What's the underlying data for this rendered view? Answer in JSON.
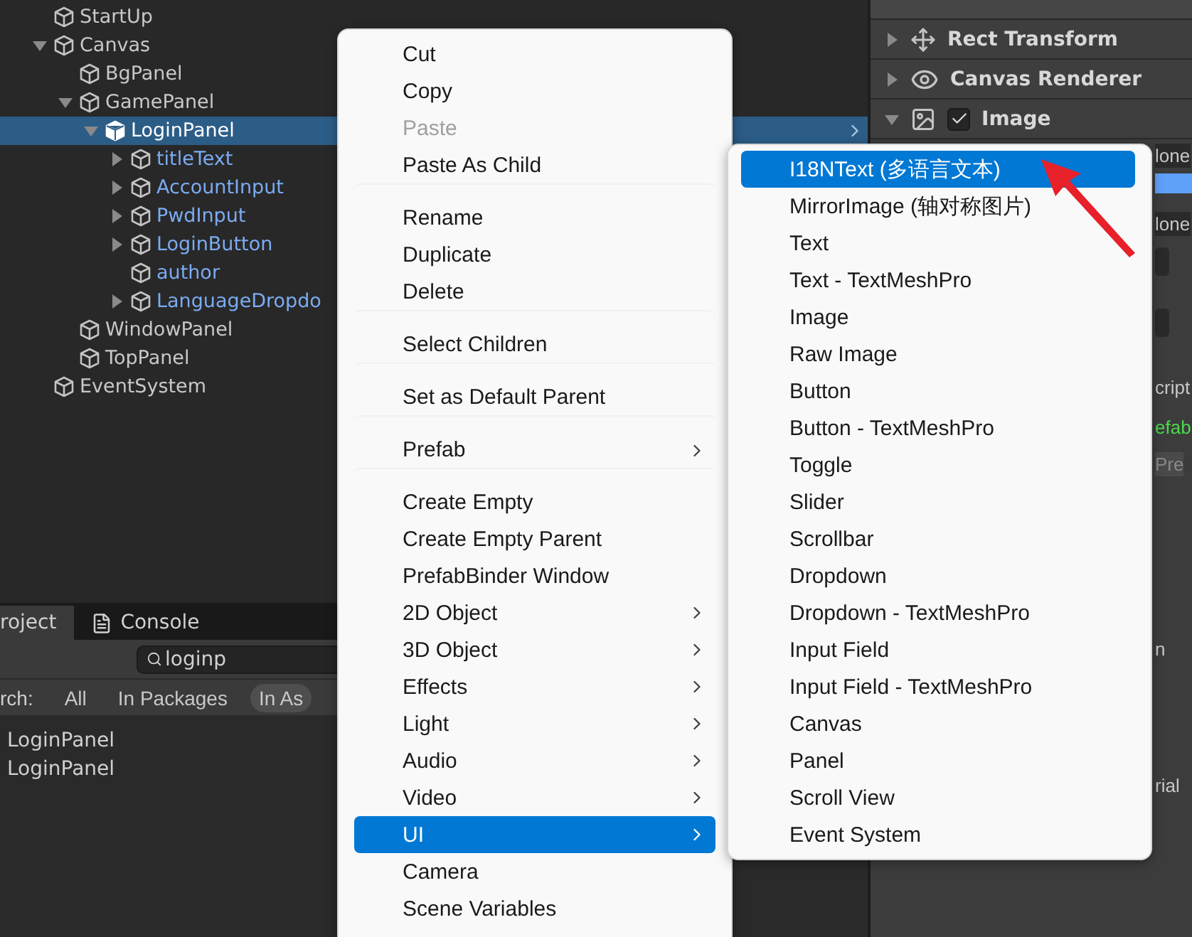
{
  "hierarchy": {
    "items": [
      {
        "name": "StartUp",
        "prefab": false,
        "selected": false
      },
      {
        "name": "Canvas",
        "prefab": false,
        "selected": false,
        "expanded": true,
        "children": [
          {
            "name": "BgPanel",
            "prefab": false,
            "selected": false
          },
          {
            "name": "GamePanel",
            "prefab": false,
            "selected": false,
            "expanded": true,
            "children": [
              {
                "name": "LoginPanel",
                "prefab": false,
                "selected": true,
                "expanded": true,
                "children": [
                  {
                    "name": "titleText",
                    "prefab": true,
                    "selected": false,
                    "expanded": false
                  },
                  {
                    "name": "AccountInput",
                    "prefab": true,
                    "selected": false,
                    "expanded": false
                  },
                  {
                    "name": "PwdInput",
                    "prefab": true,
                    "selected": false,
                    "expanded": false
                  },
                  {
                    "name": "LoginButton",
                    "prefab": true,
                    "selected": false,
                    "expanded": false
                  },
                  {
                    "name": "author",
                    "prefab": true,
                    "selected": false
                  },
                  {
                    "name": "LanguageDropdo",
                    "prefab": true,
                    "selected": false,
                    "expanded": false
                  }
                ]
              }
            ]
          },
          {
            "name": "WindowPanel",
            "prefab": false,
            "selected": false
          },
          {
            "name": "TopPanel",
            "prefab": false,
            "selected": false
          }
        ]
      },
      {
        "name": "EventSystem",
        "prefab": false,
        "selected": false
      }
    ]
  },
  "project": {
    "tabs": [
      {
        "label": "roject",
        "selected": true,
        "kind": "project"
      },
      {
        "label": "Console",
        "selected": false,
        "kind": "console"
      }
    ],
    "search": {
      "value": "loginp"
    },
    "search_label": "rch:",
    "filters": [
      {
        "label": "All",
        "selected": false
      },
      {
        "label": "In Packages",
        "selected": false
      },
      {
        "label": "In As",
        "selected": true
      }
    ],
    "results": [
      {
        "name": "LoginPanel"
      },
      {
        "name": "LoginPanel"
      }
    ]
  },
  "inspector": {
    "components": [
      {
        "title": "Rect Transform",
        "kind": "transform",
        "expanded": false
      },
      {
        "title": "Canvas Renderer",
        "kind": "renderer",
        "expanded": false
      },
      {
        "title": "Image",
        "kind": "image",
        "expanded": true,
        "checked": true
      }
    ],
    "fields": [
      {
        "kind": "field",
        "text": "lone"
      },
      {
        "kind": "bar"
      },
      {
        "kind": "field",
        "text": "lone"
      },
      {
        "kind": "dropdown"
      },
      {
        "kind": "dropdown"
      },
      {
        "kind": "label",
        "text": "cript"
      },
      {
        "kind": "link",
        "text": "efab"
      },
      {
        "kind": "button",
        "text": "Pre"
      },
      {
        "kind": "label",
        "text": "n"
      },
      {
        "kind": "label",
        "text": "rial"
      }
    ]
  },
  "context_menu": {
    "items": [
      {
        "label": "Cut",
        "disabled": false,
        "submenu": false,
        "selected": false,
        "separator_before": false
      },
      {
        "label": "Copy",
        "disabled": false,
        "submenu": false,
        "selected": false,
        "separator_before": false
      },
      {
        "label": "Paste",
        "disabled": true,
        "submenu": false,
        "selected": false,
        "separator_before": false
      },
      {
        "label": "Paste As Child",
        "disabled": false,
        "submenu": false,
        "selected": false,
        "separator_before": false
      },
      {
        "label": "Rename",
        "disabled": false,
        "submenu": false,
        "selected": false,
        "separator_before": true
      },
      {
        "label": "Duplicate",
        "disabled": false,
        "submenu": false,
        "selected": false,
        "separator_before": false
      },
      {
        "label": "Delete",
        "disabled": false,
        "submenu": false,
        "selected": false,
        "separator_before": false
      },
      {
        "label": "Select Children",
        "disabled": false,
        "submenu": false,
        "selected": false,
        "separator_before": true
      },
      {
        "label": "Set as Default Parent",
        "disabled": false,
        "submenu": false,
        "selected": false,
        "separator_before": true
      },
      {
        "label": "Prefab",
        "disabled": false,
        "submenu": true,
        "selected": false,
        "separator_before": true
      },
      {
        "label": "Create Empty",
        "disabled": false,
        "submenu": false,
        "selected": false,
        "separator_before": true
      },
      {
        "label": "Create Empty Parent",
        "disabled": false,
        "submenu": false,
        "selected": false,
        "separator_before": false
      },
      {
        "label": "PrefabBinder Window",
        "disabled": false,
        "submenu": false,
        "selected": false,
        "separator_before": false
      },
      {
        "label": "2D Object",
        "disabled": false,
        "submenu": true,
        "selected": false,
        "separator_before": false
      },
      {
        "label": "3D Object",
        "disabled": false,
        "submenu": true,
        "selected": false,
        "separator_before": false
      },
      {
        "label": "Effects",
        "disabled": false,
        "submenu": true,
        "selected": false,
        "separator_before": false
      },
      {
        "label": "Light",
        "disabled": false,
        "submenu": true,
        "selected": false,
        "separator_before": false
      },
      {
        "label": "Audio",
        "disabled": false,
        "submenu": true,
        "selected": false,
        "separator_before": false
      },
      {
        "label": "Video",
        "disabled": false,
        "submenu": true,
        "selected": false,
        "separator_before": false
      },
      {
        "label": "UI",
        "disabled": false,
        "submenu": true,
        "selected": true,
        "separator_before": false
      },
      {
        "label": "Camera",
        "disabled": false,
        "submenu": false,
        "selected": false,
        "separator_before": false
      },
      {
        "label": "Scene Variables",
        "disabled": false,
        "submenu": false,
        "selected": false,
        "separator_before": false
      }
    ]
  },
  "submenu": {
    "items": [
      {
        "label": "I18NText (多语言文本)",
        "selected": true
      },
      {
        "label": "MirrorImage (轴对称图片)",
        "selected": false
      },
      {
        "label": "Text",
        "selected": false
      },
      {
        "label": "Text - TextMeshPro",
        "selected": false
      },
      {
        "label": "Image",
        "selected": false
      },
      {
        "label": "Raw Image",
        "selected": false
      },
      {
        "label": "Button",
        "selected": false
      },
      {
        "label": "Button - TextMeshPro",
        "selected": false
      },
      {
        "label": "Toggle",
        "selected": false
      },
      {
        "label": "Slider",
        "selected": false
      },
      {
        "label": "Scrollbar",
        "selected": false
      },
      {
        "label": "Dropdown",
        "selected": false
      },
      {
        "label": "Dropdown - TextMeshPro",
        "selected": false
      },
      {
        "label": "Input Field",
        "selected": false
      },
      {
        "label": "Input Field - TextMeshPro",
        "selected": false
      },
      {
        "label": "Canvas",
        "selected": false
      },
      {
        "label": "Panel",
        "selected": false
      },
      {
        "label": "Scroll View",
        "selected": false
      },
      {
        "label": "Event System",
        "selected": false
      }
    ]
  }
}
